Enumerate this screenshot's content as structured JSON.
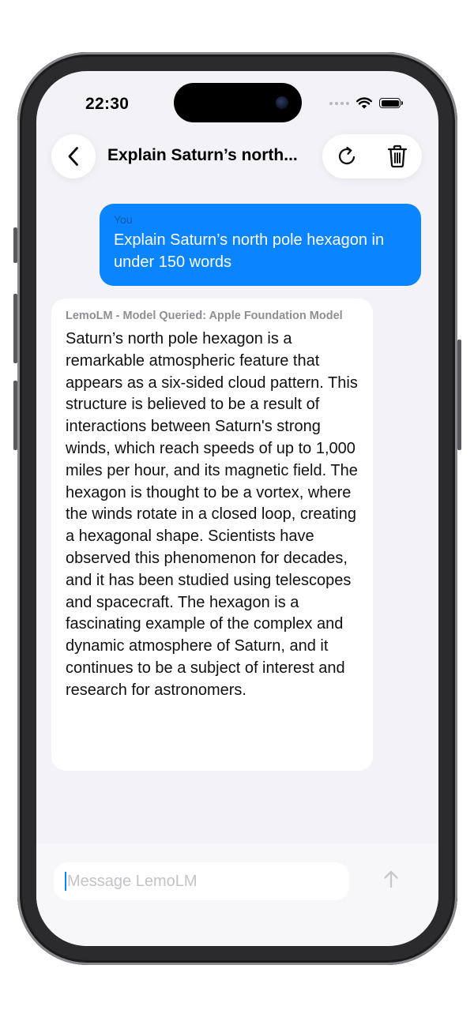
{
  "status_bar": {
    "time": "22:30"
  },
  "nav": {
    "title": "Explain Saturn’s north...",
    "icons": [
      "chevron-left-icon",
      "refresh-icon",
      "trash-icon"
    ]
  },
  "messages": [
    {
      "role": "user",
      "label": "You",
      "text": "Explain Saturn’s north pole hexagon in under 150 words"
    },
    {
      "role": "assistant",
      "label": "LemoLM - Model Queried: Apple Foundation Model",
      "text": "Saturn’s north pole hexagon is a remarkable atmospheric feature that appears as a six-sided cloud pattern. This structure is believed to be a result of interactions between Saturn's strong winds, which reach speeds of up to 1,000 miles per hour, and its magnetic field. The hexagon is thought to be a vortex, where the winds rotate in a closed loop, creating a hexagonal shape. Scientists have observed this phenomenon for decades, and it has been studied using telescopes and spacecraft. The hexagon is a fascinating example of the complex and dynamic atmosphere of Saturn, and it continues to be a subject of interest and research for astronomers."
    }
  ],
  "composer": {
    "placeholder": "Message LemoLM",
    "value": ""
  },
  "colors": {
    "accent": "#0a84ff",
    "background": "#f2f2f7",
    "bubble_user": "#0a84ff",
    "bubble_assistant": "#ffffff"
  }
}
